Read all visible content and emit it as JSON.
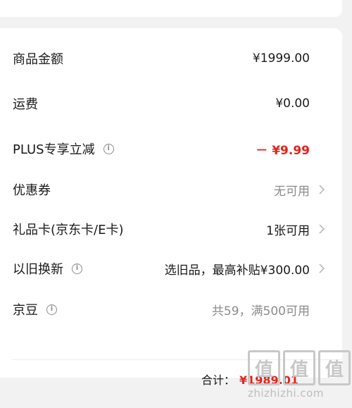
{
  "order_summary": {
    "rows": [
      {
        "label": "商品金额",
        "value": "¥1999.00"
      },
      {
        "label": "运费",
        "value": "¥0.00"
      },
      {
        "label": "PLUS专享立减",
        "value": "－ ¥9.99"
      },
      {
        "label": "优惠券",
        "value": "无可用"
      },
      {
        "label": "礼品卡(京东卡/E卡)",
        "value": "1张可用"
      },
      {
        "label": "以旧换新",
        "value": "选旧品，最高补贴¥300.00"
      },
      {
        "label": "京豆",
        "value": "共59，满500可用"
      }
    ],
    "total_label": "合计：",
    "total_value": "¥1989.01"
  },
  "watermark": {
    "logo": "值值值",
    "text": "zhizhizhi.com"
  },
  "colors": {
    "accent_red": "#e2231a",
    "muted_grey": "#8c8c8c",
    "background": "#f2f2f2"
  }
}
